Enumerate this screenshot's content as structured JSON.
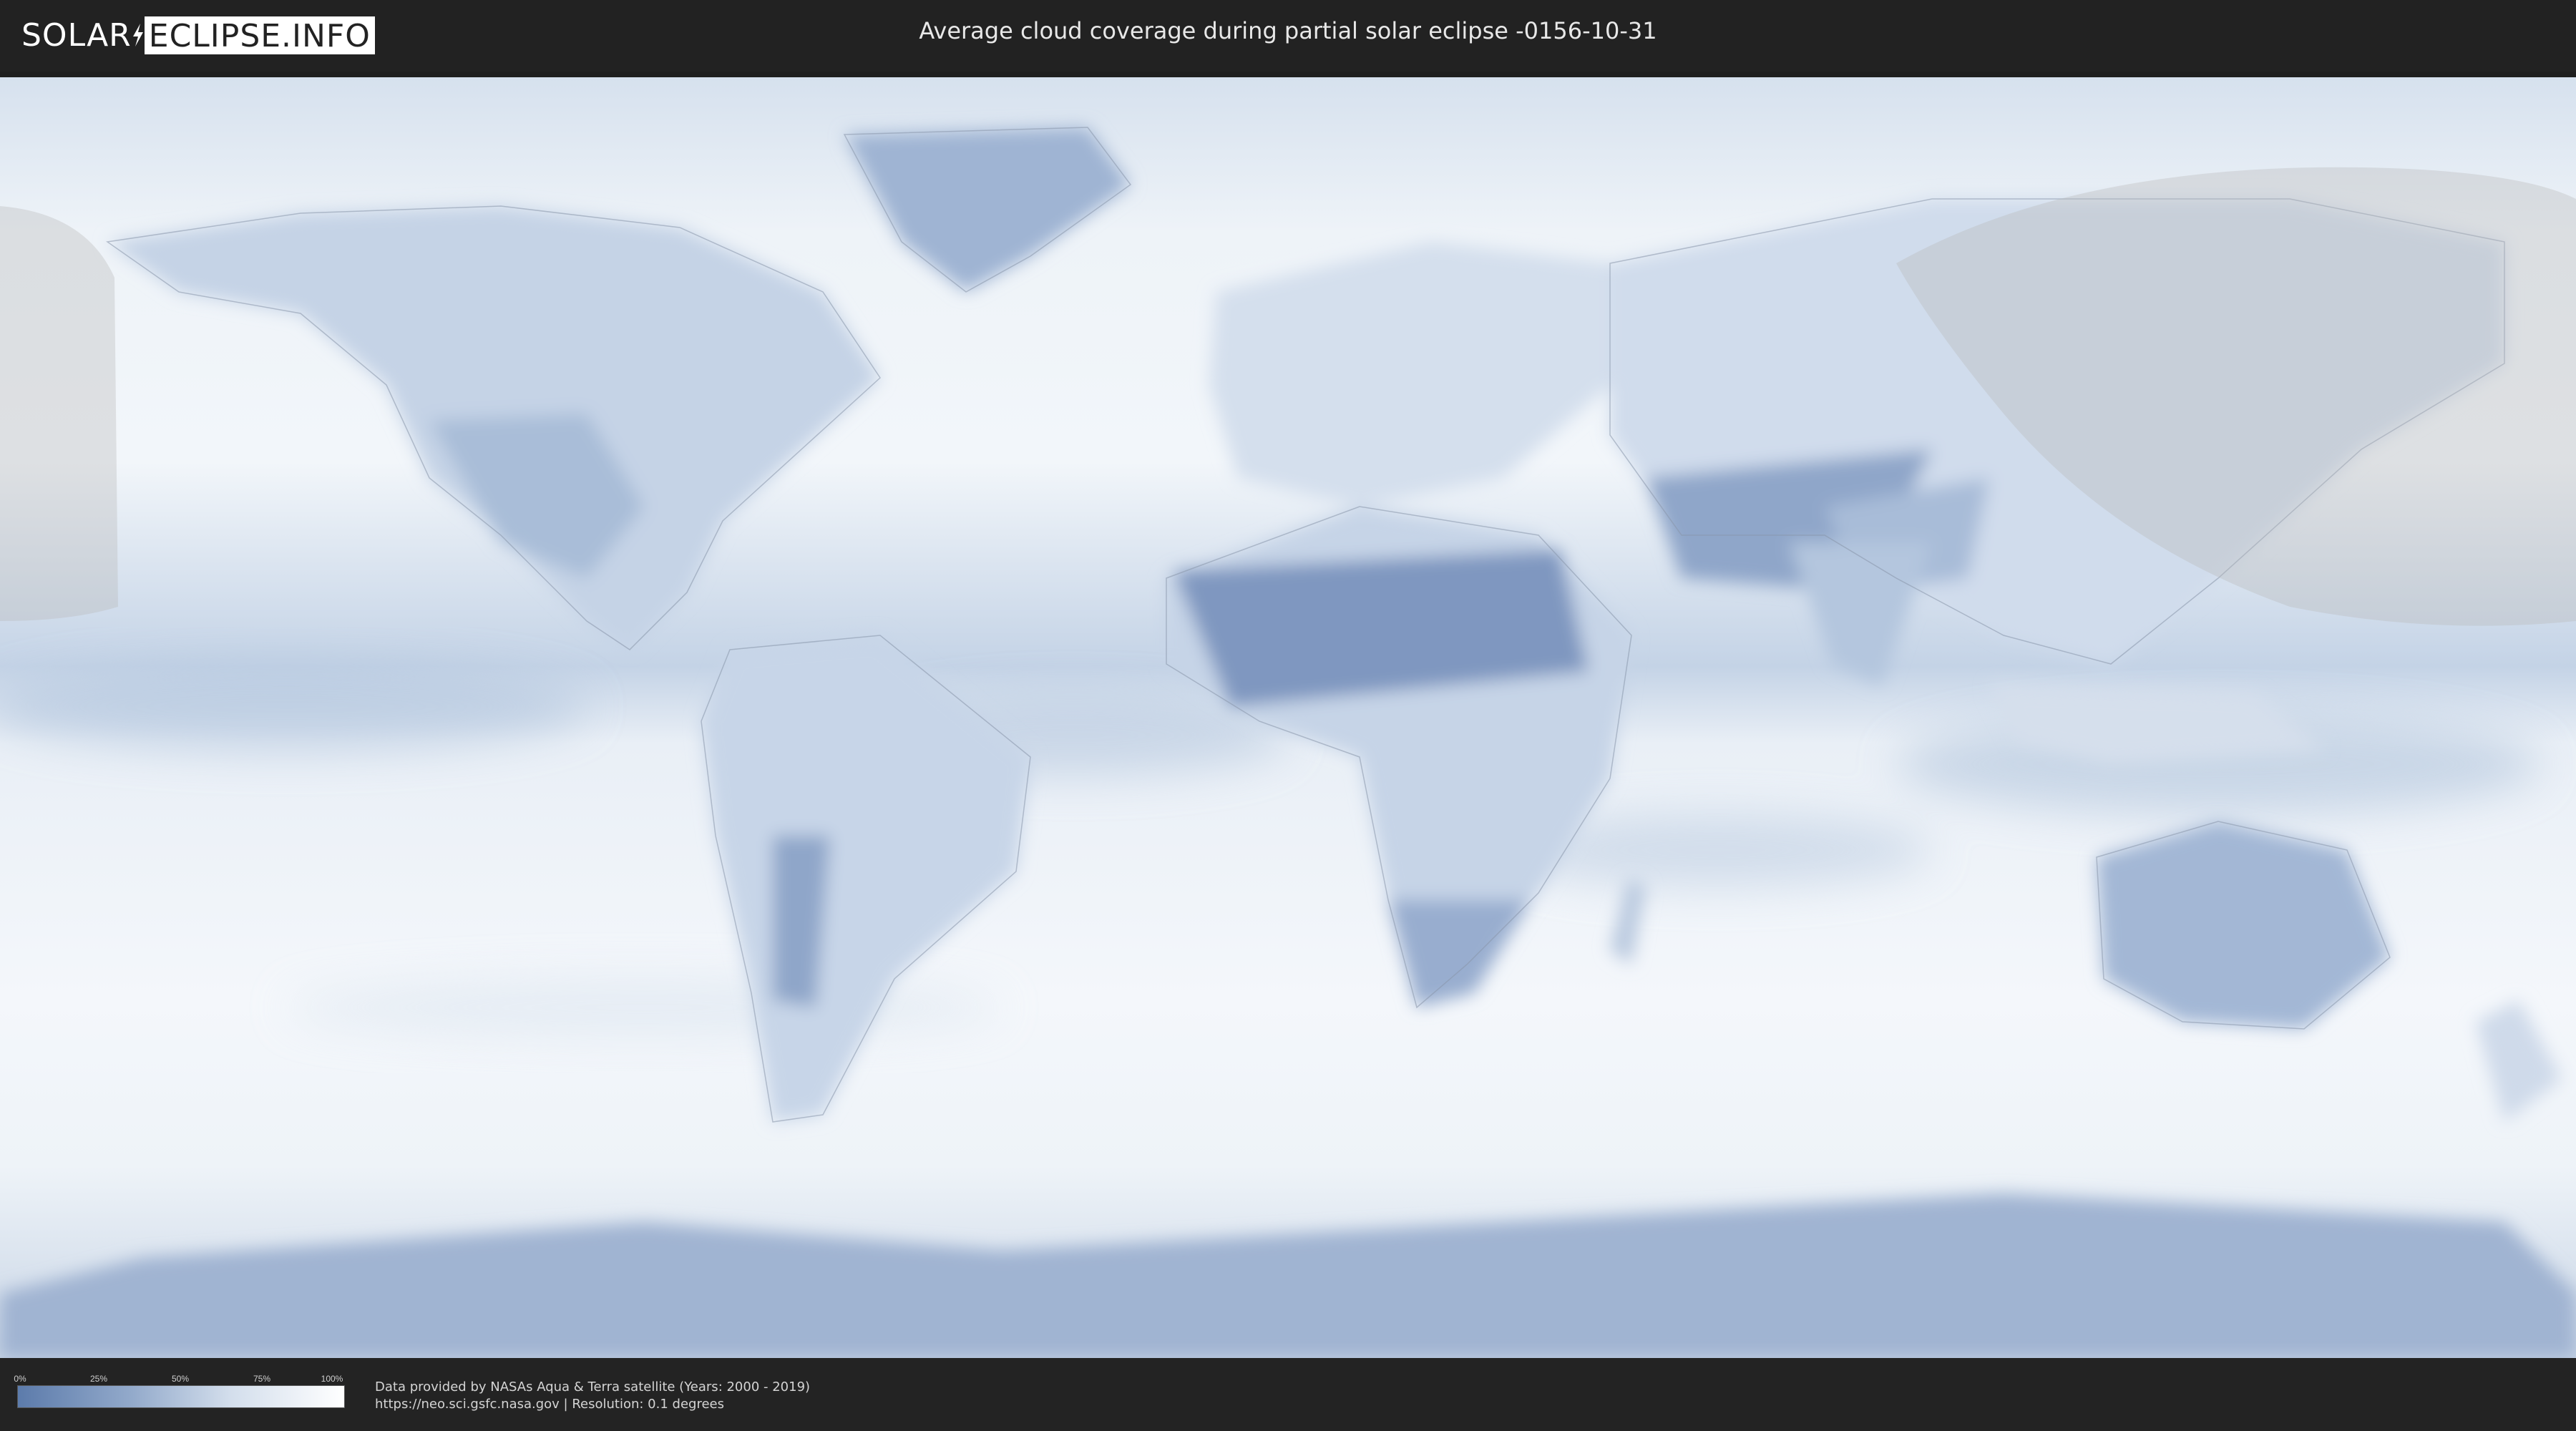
{
  "header": {
    "logo_left": "SOLAR",
    "logo_right": "ECLIPSE.INFO",
    "title": "Average cloud coverage during partial solar eclipse -0156-10-31"
  },
  "legend": {
    "ticks": [
      "0%",
      "25%",
      "50%",
      "75%",
      "100%"
    ],
    "low_color": "#5c7bab",
    "high_color": "#ffffff"
  },
  "footer": {
    "line1": "Data provided by NASAs Aqua & Terra satellite (Years: 2000 - 2019)",
    "line2": "https://neo.sci.gsfc.nasa.gov | Resolution: 0.1 degrees"
  },
  "colors": {
    "background": "#1f1f1f",
    "clear_sky": "#5c7bab",
    "overcast": "#ffffff",
    "eclipse_zone": "#c8c8c8"
  }
}
